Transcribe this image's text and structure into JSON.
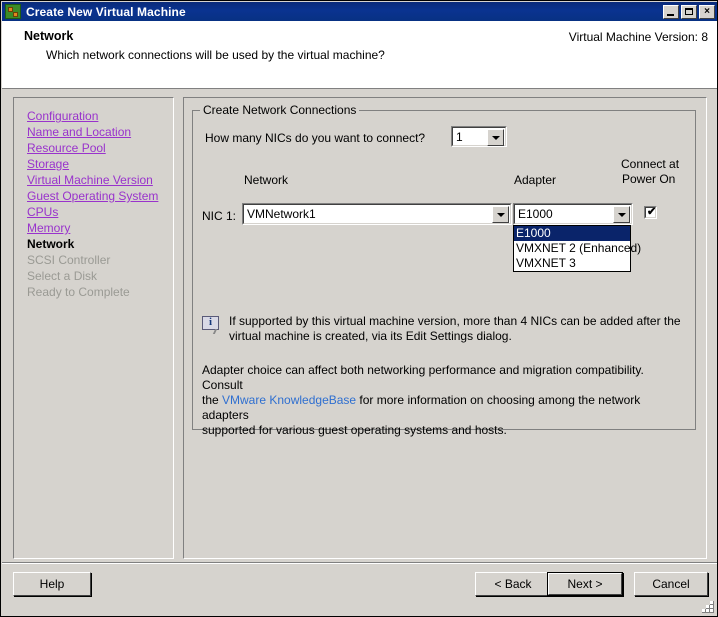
{
  "window": {
    "title": "Create New Virtual Machine",
    "icon": "vm-app-icon",
    "minimize_label": "_",
    "maximize_label": "□",
    "close_label": "×"
  },
  "header": {
    "title": "Network",
    "subtitle": "Which network connections will be used by the virtual machine?",
    "version": "Virtual Machine Version: 8"
  },
  "sidebar": {
    "items": [
      {
        "label": "Configuration",
        "state": "done"
      },
      {
        "label": "Name and Location",
        "state": "done"
      },
      {
        "label": "Resource Pool",
        "state": "done"
      },
      {
        "label": "Storage",
        "state": "done"
      },
      {
        "label": "Virtual Machine Version",
        "state": "done"
      },
      {
        "label": "Guest Operating System",
        "state": "done"
      },
      {
        "label": "CPUs",
        "state": "done"
      },
      {
        "label": "Memory",
        "state": "done"
      },
      {
        "label": "Network",
        "state": "current"
      },
      {
        "label": "SCSI Controller",
        "state": "todo"
      },
      {
        "label": "Select a Disk",
        "state": "todo"
      },
      {
        "label": "Ready to Complete",
        "state": "todo"
      }
    ]
  },
  "main": {
    "groupbox_title": "Create Network Connections",
    "nic_count_question": "How many NICs do you want to connect?",
    "nic_count_value": "1",
    "column_network": "Network",
    "column_adapter": "Adapter",
    "column_connect_line1": "Connect at",
    "column_connect_line2": "Power On",
    "nic_row_label": "NIC 1:",
    "network_value": "VMNetwork1",
    "adapter_value": "E1000",
    "adapter_options": [
      {
        "label": "E1000",
        "selected": true
      },
      {
        "label": "VMXNET 2 (Enhanced)",
        "selected": false
      },
      {
        "label": "VMXNET 3",
        "selected": false
      }
    ],
    "connect_checked": true,
    "checkbox_tick": "✔",
    "info_icon": "info-screen-icon",
    "info_note_line1": "If supported by this virtual machine version, more than 4 NICs can be added after the",
    "info_note_line2": "virtual machine is created, via its Edit Settings dialog.",
    "adapter_note_part1": "Adapter choice can affect both networking performance and migration compatibility. Consult",
    "adapter_note_part2": "the ",
    "adapter_note_link": "VMware KnowledgeBase",
    "adapter_note_part3": " for more information on choosing among the network adapters",
    "adapter_note_part4": "supported for various guest operating systems and hosts."
  },
  "footer": {
    "help_label": "Help",
    "back_label": "< Back",
    "next_label": "Next >",
    "cancel_label": "Cancel"
  },
  "colors": {
    "titlebar": "#0a2f85",
    "face": "#d6d3ce",
    "link": "#9933cc",
    "hyperlink": "#2f6fd0",
    "selection": "#0a246a"
  }
}
